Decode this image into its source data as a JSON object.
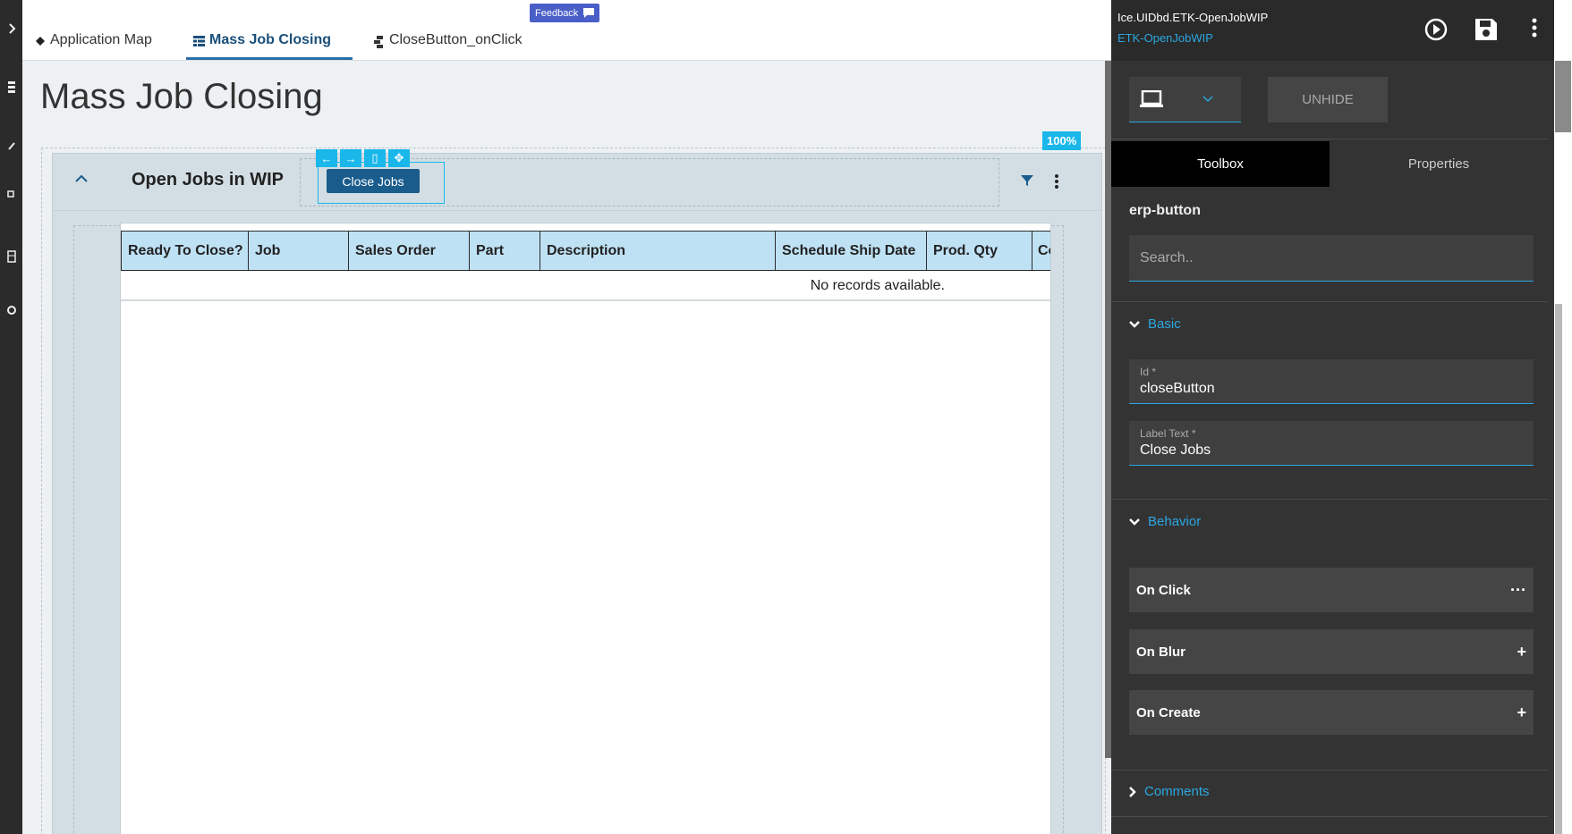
{
  "tabs": [
    {
      "label": "Application Map",
      "icon": "diamond-icon"
    },
    {
      "label": "Mass Job Closing",
      "icon": "grid-icon"
    },
    {
      "label": "CloseButton_onClick",
      "icon": "flow-icon"
    }
  ],
  "feedback_label": "Feedback",
  "page_title": "Mass Job Closing",
  "zoom": "100%",
  "panel": {
    "title": "Open Jobs in WIP",
    "button_label": "Close Jobs",
    "mini_tools": [
      "←",
      "→",
      "▯",
      "✥"
    ]
  },
  "grid": {
    "columns": [
      "Ready To Close?",
      "Job",
      "Sales Order",
      "Part",
      "Description",
      "Schedule Ship Date",
      "Prod. Qty",
      "Co"
    ],
    "empty_text": "No records available."
  },
  "side": {
    "path": "Ice.UIDbd.ETK-OpenJobWIP",
    "app": "ETK-OpenJobWIP",
    "unhide_label": "UNHIDE",
    "tabs": [
      "Toolbox",
      "Properties"
    ],
    "component": "erp-button",
    "search_placeholder": "Search..",
    "sections": {
      "basic": "Basic",
      "behavior": "Behavior",
      "comments": "Comments"
    },
    "fields": [
      {
        "label": "Id *",
        "value": "closeButton"
      },
      {
        "label": "Label Text *",
        "value": "Close Jobs"
      }
    ],
    "events": [
      {
        "label": "On Click",
        "action": "···"
      },
      {
        "label": "On Blur",
        "action": "+"
      },
      {
        "label": "On Create",
        "action": "+"
      }
    ]
  },
  "colors": {
    "accent": "#2ba8e0",
    "selection": "#1ab7ea",
    "button": "#1a5c8c",
    "header_cell": "#bfe1f4"
  }
}
